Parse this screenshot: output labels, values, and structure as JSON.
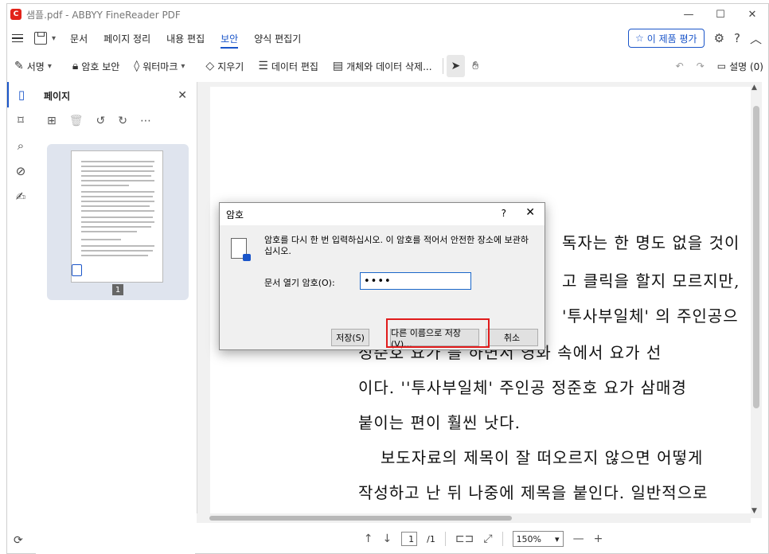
{
  "window": {
    "title": "샘플.pdf - ABBYY FineReader PDF",
    "app_icon_glyph": "C",
    "controls": [
      "—",
      "☐",
      "✕"
    ]
  },
  "menu": {
    "items": [
      "문서",
      "페이지 정리",
      "내용 편집",
      "보안",
      "양식 편집기"
    ],
    "active_index": 3,
    "rate_label": "이 제품 평가",
    "right_icons": [
      "gear-icon",
      "help-icon",
      "collapse-icon"
    ]
  },
  "toolbar": {
    "sign": "서명",
    "password_protect": "암호 보안",
    "watermark": "워터마크",
    "erase": "지우기",
    "redact_data": "데이터 편집",
    "delete_objects": "개체와 데이터 삭제...",
    "comments": "설명 (0)"
  },
  "panel": {
    "title": "페이지",
    "page_number": "1"
  },
  "document": {
    "lines": [
      "독자는 한 명도 없을 것이",
      "고 클릭을 할지 모르지만,",
      "'투사부일체' 의 주인공으",
      "정준호 요가 를 하면서 영화 속에서 요가 선",
      "이다. ''투사부일체' 주인공 정준호 요가 삼매경",
      "붙이는 편이 훨씬 낫다.",
      "보도자료의 제목이 잘 떠오르지 않으면 어떻게",
      "작성하고 난 뒤 나중에 제목을 붙인다. 일반적으로"
    ]
  },
  "statusbar": {
    "current_page": "1",
    "total_pages": "/1",
    "zoom": "150%"
  },
  "dialog": {
    "title": "암호",
    "help": "?",
    "close": "✕",
    "message": "암호를 다시 한 번 입력하십시오. 이 암호를 적어서 안전한 장소에 보관하십시오.",
    "field_label": "문서 열기 암호(O):",
    "field_value": "••••",
    "save_button": "저장(S)",
    "save_as_button": "다른 이름으로 저장(V)...",
    "cancel_button": "취소"
  }
}
